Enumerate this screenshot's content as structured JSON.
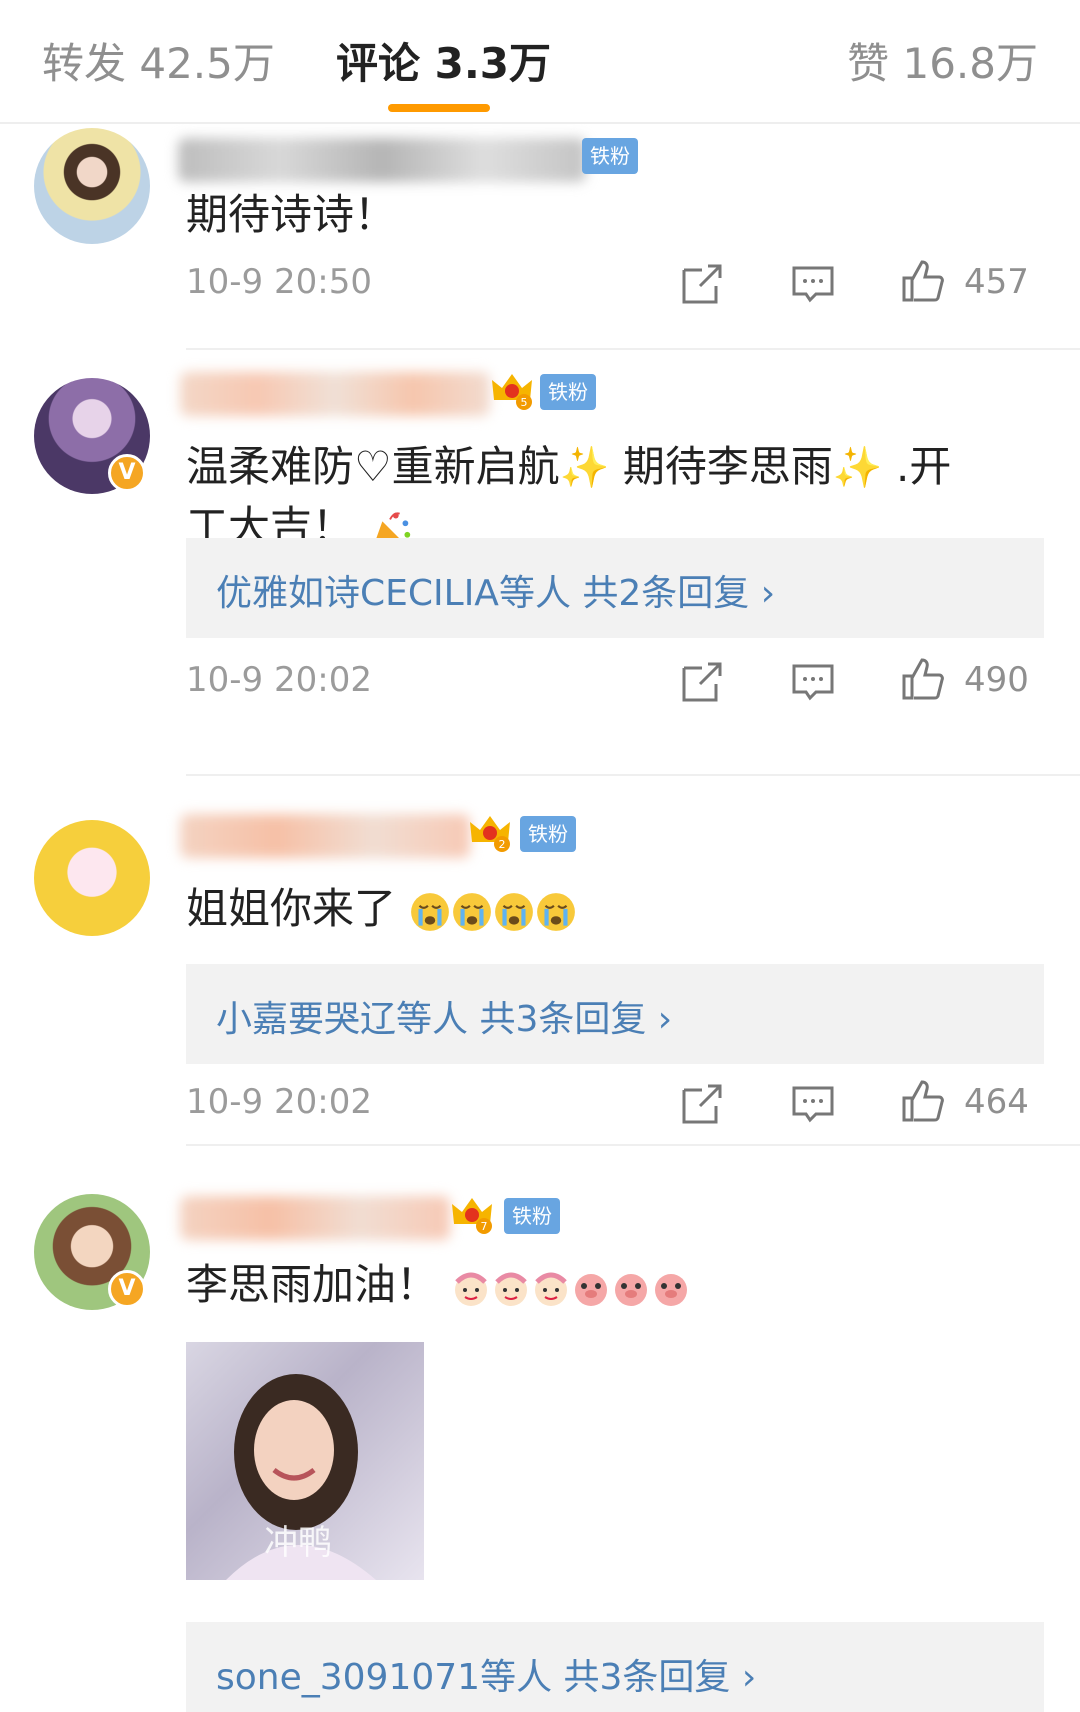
{
  "tabs": {
    "repost": "转发 42.5万",
    "comments": "评论 3.3万",
    "likes": "赞 16.8万"
  },
  "badges": {
    "fan": "铁粉",
    "verified_symbol": "V"
  },
  "comments": [
    {
      "text": "期待诗诗！",
      "time": "10-9 20:50",
      "likes": "457"
    },
    {
      "text_line1_a": "温柔难防♡重新启航",
      "text_line1_b": " 期待李思雨",
      "text_line1_c": " .开",
      "text_line2": "工大吉！",
      "reply_link": "优雅如诗CECILIA等人  共2条回复 ›",
      "time": "10-9 20:02",
      "likes": "490",
      "crown_level": "5"
    },
    {
      "text": "姐姐你来了",
      "reply_link": "小嘉要哭辽等人  共3条回复 ›",
      "time": "10-9 20:02",
      "likes": "464",
      "crown_level": "2"
    },
    {
      "text": "李思雨加油！",
      "photo_caption": "冲鸭",
      "reply_link": "sone_3091071等人  共3条回复 ›",
      "crown_level": "7"
    }
  ],
  "colors": {
    "accent": "#ff9a00",
    "fan_badge": "#68a5e1",
    "link": "#4b7fb5",
    "verified": "#f5a623"
  },
  "icons": [
    "repost-icon",
    "comment-icon",
    "like-icon",
    "crown-icon",
    "sparkle-icon",
    "party-popper-icon",
    "crying-face-icon"
  ]
}
